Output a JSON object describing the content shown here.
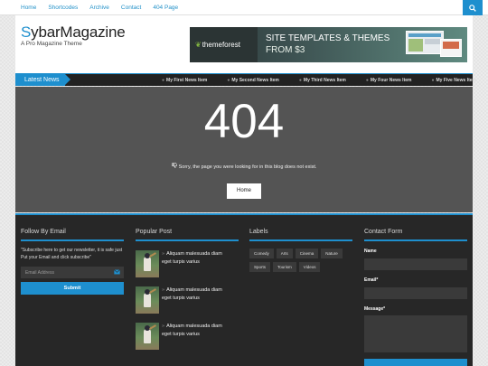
{
  "topnav": {
    "items": [
      "Home",
      "Shortcodes",
      "Archive",
      "Contact",
      "404 Page"
    ],
    "search_icon": "search-icon"
  },
  "header": {
    "logo_first": "S",
    "logo_rest": "ybarMagazine",
    "tagline": "A Pro Magazine Theme",
    "banner": {
      "brand": "themeforest",
      "headline": "SITE TEMPLATES & THEMES",
      "price": "FROM $3"
    }
  },
  "newsbar": {
    "label": "Latest News",
    "items": [
      "My First News Item",
      "My Second News Item",
      "My Third News Item",
      "My Four News Item",
      "My Five News Item"
    ]
  },
  "error": {
    "code": "404",
    "message": "Sorry, the page you were looking for in this blog does not exist.",
    "home_label": "Home"
  },
  "footer": {
    "follow": {
      "title": "Follow By Email",
      "text": "\"Subscribe here to get our newsletter, it is safe just Put your Email and click subscribe\"",
      "email_placeholder": "Email Address",
      "submit_label": "Submit"
    },
    "popular": {
      "title": "Popular Post",
      "posts": [
        {
          "line1": "Aliquam malesuada diam",
          "line2": "eget turpis varius"
        },
        {
          "line1": "Aliquam malesuada diam",
          "line2": "eget turpis varius"
        },
        {
          "line1": "Aliquam malesuada diam",
          "line2": "eget turpis varius"
        }
      ]
    },
    "labels": {
      "title": "Labels",
      "tags": [
        "Comedy",
        "Arts",
        "Cinema",
        "Nature",
        "Sports",
        "Tourism",
        "Videos"
      ]
    },
    "contact": {
      "title": "Contact Form",
      "name_label": "Name",
      "email_label": "Email*",
      "message_label": "Message*"
    }
  },
  "colors": {
    "accent": "#1e8fce",
    "dark": "#272727",
    "panel": "#545454"
  }
}
